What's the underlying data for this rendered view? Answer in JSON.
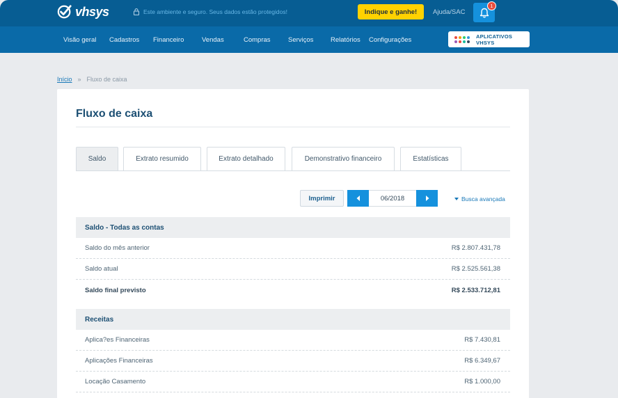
{
  "header": {
    "logo_text": "vhsys",
    "secure_text": "Este ambiente e seguro. Seus dados estão protegidos!",
    "indique_label": "Indique e ganhe!",
    "help_label": "Ajuda/SAC",
    "notifications_count": "1"
  },
  "nav": {
    "items": [
      "Visão geral",
      "Cadastros",
      "Financeiro",
      "Vendas",
      "Compras",
      "Serviços",
      "Relatórios",
      "Configurações"
    ],
    "apps_label": "APLICATIVOS VHSYS"
  },
  "breadcrumb": {
    "home": "Início",
    "separator": "»",
    "current": "Fluxo de caixa"
  },
  "page": {
    "title": "Fluxo de caixa",
    "tabs": [
      "Saldo",
      "Extrato resumido",
      "Extrato detalhado",
      "Demonstrativo financeiro",
      "Estatísticas"
    ],
    "active_tab": "Saldo",
    "print_label": "Imprimir",
    "period": "06/2018",
    "advanced_search": "Busca avançada"
  },
  "saldo": {
    "title": "Saldo - Todas as contas",
    "rows": [
      {
        "label": "Saldo do mês anterior",
        "value": "R$ 2.807.431,78"
      },
      {
        "label": "Saldo atual",
        "value": "R$ 2.525.561,38"
      },
      {
        "label": "Saldo final previsto",
        "value": "R$ 2.533.712,81"
      }
    ]
  },
  "receitas": {
    "title": "Receitas",
    "rows": [
      {
        "label": "Aplica?es Financeiras",
        "value": "R$ 7.430,81"
      },
      {
        "label": "Aplicações Financeiras",
        "value": "R$ 6.349,67"
      },
      {
        "label": "Locação Casamento",
        "value": "R$ 1.000,00"
      }
    ]
  },
  "colors": {
    "topbar": "#075d93",
    "navbar": "#0a6aa8",
    "accent": "#1591dd",
    "yellow": "#ffd200",
    "apps_dots": [
      "#e84c3d",
      "#f39c12",
      "#2ecc71",
      "#3498db",
      "#9b59b6",
      "#e84c3d",
      "#1abc9c",
      "#34495e"
    ]
  }
}
